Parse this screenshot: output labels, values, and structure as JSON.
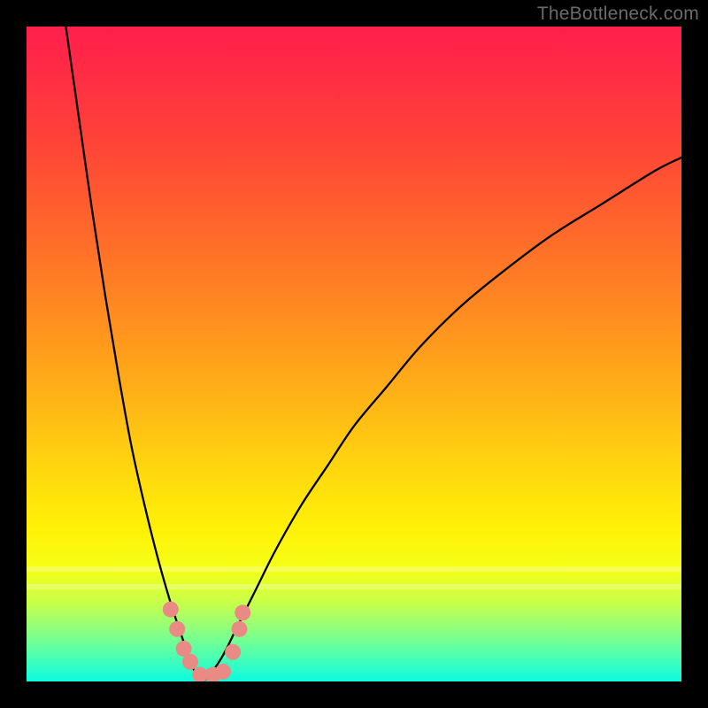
{
  "watermark": "TheBottleneck.com",
  "colors": {
    "frame": "#000000",
    "curve": "#000000",
    "marker": "#e98a84",
    "gradient_top": "#ff1f4b",
    "gradient_bottom": "#0bfce0"
  },
  "chart_data": {
    "type": "line",
    "title": "",
    "xlabel": "",
    "ylabel": "",
    "xlim": [
      0,
      100
    ],
    "ylim": [
      0,
      100
    ],
    "notes": "Gradient heat background red→green top→bottom; two branches forming a V with minimum ~x=27; small pink marker cluster near the trough.",
    "series": [
      {
        "name": "left-branch",
        "x": [
          6,
          8,
          10,
          12,
          14,
          16,
          18,
          20,
          22,
          24,
          25,
          26,
          27
        ],
        "y": [
          100,
          86,
          72,
          59,
          47,
          36,
          27,
          19,
          12,
          6,
          3,
          1,
          0
        ]
      },
      {
        "name": "right-branch",
        "x": [
          27,
          28,
          30,
          32,
          35,
          38,
          42,
          46,
          50,
          55,
          60,
          66,
          72,
          80,
          88,
          96,
          100
        ],
        "y": [
          0,
          1,
          4,
          8,
          14,
          20,
          27,
          33,
          39,
          45,
          51,
          57,
          62,
          68,
          73,
          78,
          80
        ]
      }
    ],
    "markers": [
      {
        "x": 22.0,
        "y": 11.0
      },
      {
        "x": 23.0,
        "y": 8.0
      },
      {
        "x": 24.0,
        "y": 5.0
      },
      {
        "x": 25.0,
        "y": 3.0
      },
      {
        "x": 26.5,
        "y": 1.0
      },
      {
        "x": 28.5,
        "y": 1.0
      },
      {
        "x": 30.0,
        "y": 1.5
      },
      {
        "x": 31.5,
        "y": 4.5
      },
      {
        "x": 32.5,
        "y": 8.0
      },
      {
        "x": 33.0,
        "y": 10.5
      }
    ]
  }
}
